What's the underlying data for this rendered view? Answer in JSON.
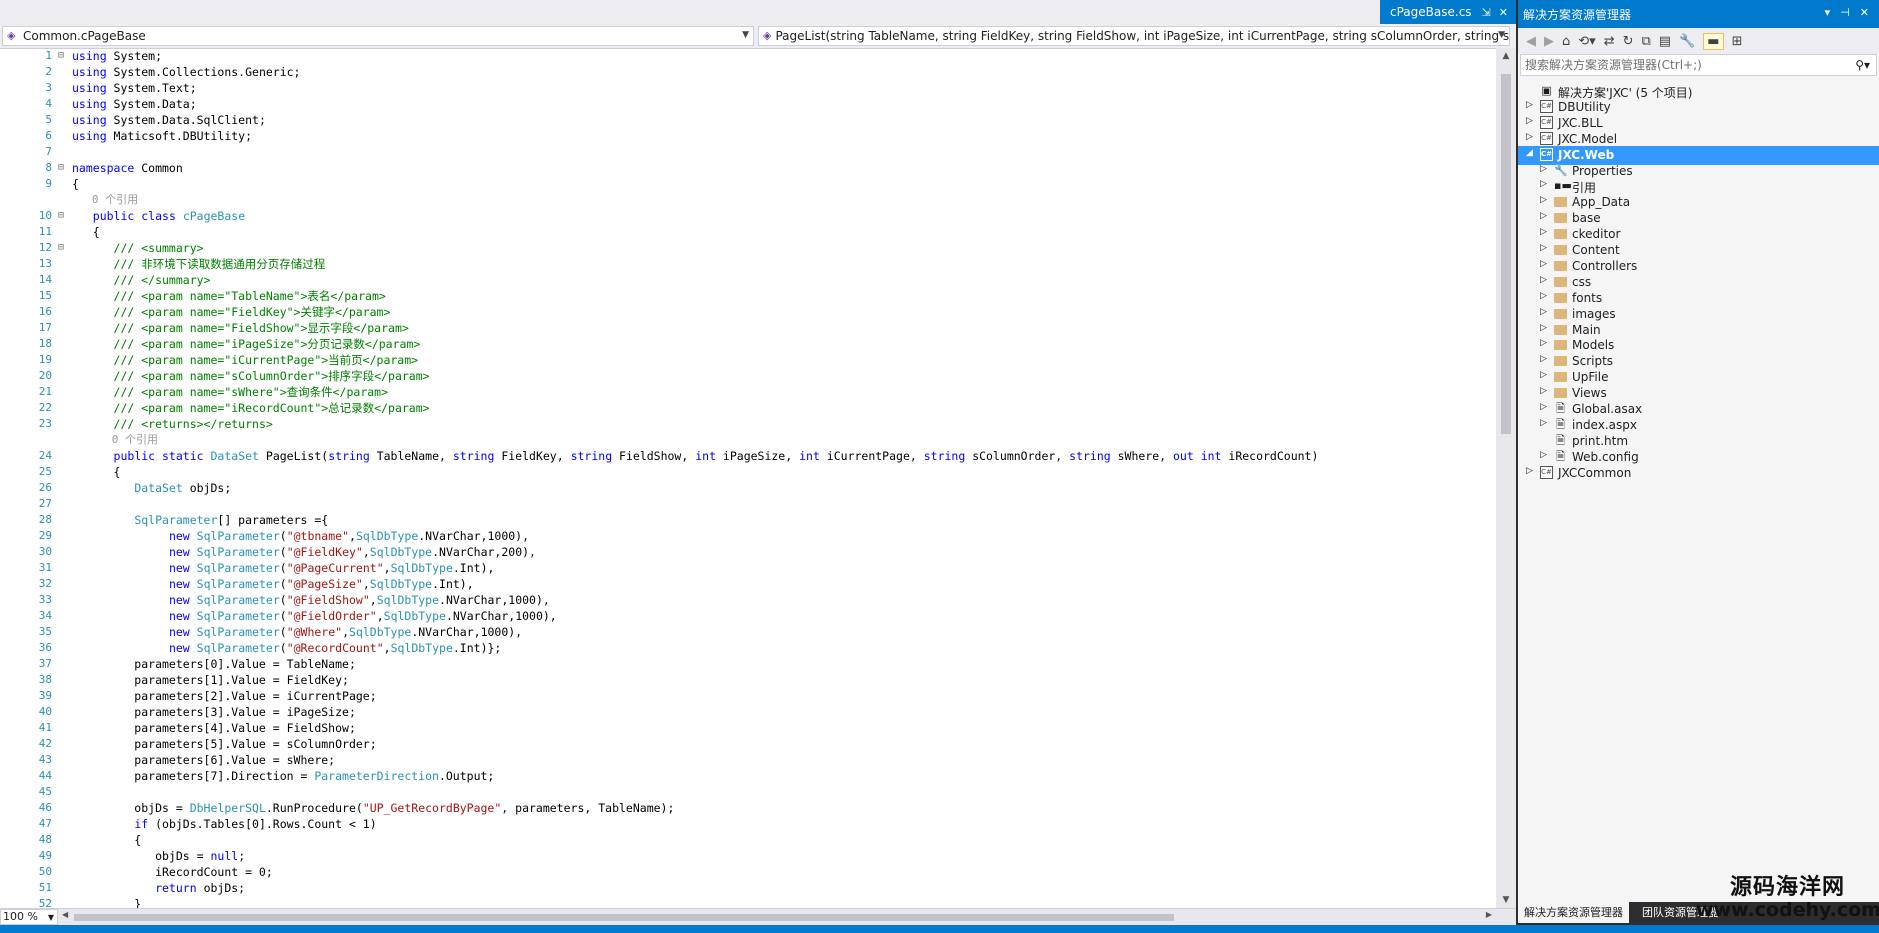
{
  "editor": {
    "file_tab": "cPageBase.cs",
    "nav_left": "Common.cPageBase",
    "nav_right": "PageList(string TableName, string FieldKey, string FieldShow, int iPageSize, int iCurrentPage, string sColumnOrder, string sW",
    "zoom": "100 %",
    "ref_text": "0 个引用",
    "lines": [
      {
        "n": "1",
        "o": "⊟",
        "html": "<span class='kw'>using</span> System;"
      },
      {
        "n": "2",
        "html": "<span class='kw'>using</span> System.Collections.Generic;"
      },
      {
        "n": "3",
        "html": "<span class='kw'>using</span> System.Text;"
      },
      {
        "n": "4",
        "html": "<span class='kw'>using</span> System.Data;"
      },
      {
        "n": "5",
        "html": "<span class='kw'>using</span> System.Data.SqlClient;"
      },
      {
        "n": "6",
        "html": "<span class='kw'>using</span> Maticsoft.DBUtility;"
      },
      {
        "n": "7",
        "html": ""
      },
      {
        "n": "8",
        "o": "⊟",
        "html": "<span class='kw'>namespace</span> Common"
      },
      {
        "n": "9",
        "html": "{"
      },
      {
        "ref": true,
        "indent": "   "
      },
      {
        "n": "10",
        "o": "⊟",
        "html": "   <span class='kw'>public class</span> <span class='ty'>cPageBase</span>"
      },
      {
        "n": "11",
        "html": "   {"
      },
      {
        "n": "12",
        "o": "⊟",
        "html": "      <span class='cm'>/// &lt;summary&gt;</span>"
      },
      {
        "n": "13",
        "html": "      <span class='cm'>/// 非环境下读取数据通用分页存储过程</span>"
      },
      {
        "n": "14",
        "html": "      <span class='cm'>/// &lt;/summary&gt;</span>"
      },
      {
        "n": "15",
        "html": "      <span class='cm'>/// &lt;param name=\"TableName\"&gt;表名&lt;/param&gt;</span>"
      },
      {
        "n": "16",
        "html": "      <span class='cm'>/// &lt;param name=\"FieldKey\"&gt;关键字&lt;/param&gt;</span>"
      },
      {
        "n": "17",
        "html": "      <span class='cm'>/// &lt;param name=\"FieldShow\"&gt;显示字段&lt;/param&gt;</span>"
      },
      {
        "n": "18",
        "html": "      <span class='cm'>/// &lt;param name=\"iPageSize\"&gt;分页记录数&lt;/param&gt;</span>"
      },
      {
        "n": "19",
        "html": "      <span class='cm'>/// &lt;param name=\"iCurrentPage\"&gt;当前页&lt;/param&gt;</span>"
      },
      {
        "n": "20",
        "html": "      <span class='cm'>/// &lt;param name=\"sColumnOrder\"&gt;排序字段&lt;/param&gt;</span>"
      },
      {
        "n": "21",
        "html": "      <span class='cm'>/// &lt;param name=\"sWhere\"&gt;查询条件&lt;/param&gt;</span>"
      },
      {
        "n": "22",
        "html": "      <span class='cm'>/// &lt;param name=\"iRecordCount\"&gt;总记录数&lt;/param&gt;</span>"
      },
      {
        "n": "23",
        "html": "      <span class='cm'>/// &lt;returns&gt;&lt;/returns&gt;</span>"
      },
      {
        "ref": true,
        "indent": "      "
      },
      {
        "n": "24",
        "html": "      <span class='kw'>public static</span> <span class='ty'>DataSet</span> PageList(<span class='kw'>string</span> TableName, <span class='kw'>string</span> FieldKey, <span class='kw'>string</span> FieldShow, <span class='kw'>int</span> iPageSize, <span class='kw'>int</span> iCurrentPage, <span class='kw'>string</span> sColumnOrder, <span class='kw'>string</span> sWhere, <span class='kw'>out int</span> iRecordCount)"
      },
      {
        "n": "25",
        "html": "      {"
      },
      {
        "n": "26",
        "html": "         <span class='ty'>DataSet</span> objDs;"
      },
      {
        "n": "27",
        "html": ""
      },
      {
        "n": "28",
        "html": "         <span class='ty'>SqlParameter</span>[] parameters ={"
      },
      {
        "n": "29",
        "html": "              <span class='kw'>new</span> <span class='ty'>SqlParameter</span>(<span class='st'>\"@tbname\"</span>,<span class='ty'>SqlDbType</span>.NVarChar,1000),"
      },
      {
        "n": "30",
        "html": "              <span class='kw'>new</span> <span class='ty'>SqlParameter</span>(<span class='st'>\"@FieldKey\"</span>,<span class='ty'>SqlDbType</span>.NVarChar,200),"
      },
      {
        "n": "31",
        "html": "              <span class='kw'>new</span> <span class='ty'>SqlParameter</span>(<span class='st'>\"@PageCurrent\"</span>,<span class='ty'>SqlDbType</span>.Int),"
      },
      {
        "n": "32",
        "html": "              <span class='kw'>new</span> <span class='ty'>SqlParameter</span>(<span class='st'>\"@PageSize\"</span>,<span class='ty'>SqlDbType</span>.Int),"
      },
      {
        "n": "33",
        "html": "              <span class='kw'>new</span> <span class='ty'>SqlParameter</span>(<span class='st'>\"@FieldShow\"</span>,<span class='ty'>SqlDbType</span>.NVarChar,1000),"
      },
      {
        "n": "34",
        "html": "              <span class='kw'>new</span> <span class='ty'>SqlParameter</span>(<span class='st'>\"@FieldOrder\"</span>,<span class='ty'>SqlDbType</span>.NVarChar,1000),"
      },
      {
        "n": "35",
        "html": "              <span class='kw'>new</span> <span class='ty'>SqlParameter</span>(<span class='st'>\"@Where\"</span>,<span class='ty'>SqlDbType</span>.NVarChar,1000),"
      },
      {
        "n": "36",
        "html": "              <span class='kw'>new</span> <span class='ty'>SqlParameter</span>(<span class='st'>\"@RecordCount\"</span>,<span class='ty'>SqlDbType</span>.Int)};"
      },
      {
        "n": "37",
        "html": "         parameters[0].Value = TableName;"
      },
      {
        "n": "38",
        "html": "         parameters[1].Value = FieldKey;"
      },
      {
        "n": "39",
        "html": "         parameters[2].Value = iCurrentPage;"
      },
      {
        "n": "40",
        "html": "         parameters[3].Value = iPageSize;"
      },
      {
        "n": "41",
        "html": "         parameters[4].Value = FieldShow;"
      },
      {
        "n": "42",
        "html": "         parameters[5].Value = sColumnOrder;"
      },
      {
        "n": "43",
        "html": "         parameters[6].Value = sWhere;"
      },
      {
        "n": "44",
        "html": "         parameters[7].Direction = <span class='ty'>ParameterDirection</span>.Output;"
      },
      {
        "n": "45",
        "html": ""
      },
      {
        "n": "46",
        "html": "         objDs = <span class='ty'>DbHelperSQL</span>.RunProcedure(<span class='st'>\"UP_GetRecordByPage\"</span>, parameters, TableName);"
      },
      {
        "n": "47",
        "html": "         <span class='kw'>if</span> (objDs.Tables[0].Rows.Count &lt; 1)"
      },
      {
        "n": "48",
        "html": "         {"
      },
      {
        "n": "49",
        "html": "            objDs = <span class='kw'>null</span>;"
      },
      {
        "n": "50",
        "html": "            iRecordCount = 0;"
      },
      {
        "n": "51",
        "html": "            <span class='kw'>return</span> objDs;"
      },
      {
        "n": "52",
        "html": "         }"
      }
    ]
  },
  "solution_explorer": {
    "title": "解决方案资源管理器",
    "search_placeholder": "搜索解决方案资源管理器(Ctrl+;)",
    "tab_solution": "解决方案资源管理器",
    "tab_team": "团队资源管理器",
    "tree": [
      {
        "label": "解决方案'JXC' (5 个项目)",
        "level": 0,
        "type": "solution",
        "arrow": ""
      },
      {
        "label": "DBUtility",
        "level": 0,
        "type": "project",
        "arrow": "▷"
      },
      {
        "label": "JXC.BLL",
        "level": 0,
        "type": "project",
        "arrow": "▷"
      },
      {
        "label": "JXC.Model",
        "level": 0,
        "type": "project",
        "arrow": "▷"
      },
      {
        "label": "JXC.Web",
        "level": 0,
        "type": "project",
        "arrow": "◢",
        "selected": true
      },
      {
        "label": "Properties",
        "level": 1,
        "type": "wrench",
        "arrow": "▷"
      },
      {
        "label": "引用",
        "level": 1,
        "type": "refs",
        "arrow": "▷"
      },
      {
        "label": "App_Data",
        "level": 1,
        "type": "folder",
        "arrow": "▷"
      },
      {
        "label": "base",
        "level": 1,
        "type": "folder",
        "arrow": "▷"
      },
      {
        "label": "ckeditor",
        "level": 1,
        "type": "folder",
        "arrow": "▷"
      },
      {
        "label": "Content",
        "level": 1,
        "type": "folder",
        "arrow": "▷"
      },
      {
        "label": "Controllers",
        "level": 1,
        "type": "folder",
        "arrow": "▷"
      },
      {
        "label": "css",
        "level": 1,
        "type": "folder",
        "arrow": "▷"
      },
      {
        "label": "fonts",
        "level": 1,
        "type": "folder",
        "arrow": "▷"
      },
      {
        "label": "images",
        "level": 1,
        "type": "folder",
        "arrow": "▷"
      },
      {
        "label": "Main",
        "level": 1,
        "type": "folder",
        "arrow": "▷"
      },
      {
        "label": "Models",
        "level": 1,
        "type": "folder",
        "arrow": "▷"
      },
      {
        "label": "Scripts",
        "level": 1,
        "type": "folder",
        "arrow": "▷"
      },
      {
        "label": "UpFile",
        "level": 1,
        "type": "folder",
        "arrow": "▷"
      },
      {
        "label": "Views",
        "level": 1,
        "type": "folder",
        "arrow": "▷"
      },
      {
        "label": "Global.asax",
        "level": 1,
        "type": "file",
        "arrow": "▷"
      },
      {
        "label": "index.aspx",
        "level": 1,
        "type": "file",
        "arrow": "▷"
      },
      {
        "label": "print.htm",
        "level": 1,
        "type": "file",
        "arrow": ""
      },
      {
        "label": "Web.config",
        "level": 1,
        "type": "file",
        "arrow": "▷"
      },
      {
        "label": "JXCCommon",
        "level": 0,
        "type": "project",
        "arrow": "▷"
      }
    ]
  },
  "watermark": {
    "line1": "源码海洋网",
    "line2": "www.codehy.com"
  }
}
